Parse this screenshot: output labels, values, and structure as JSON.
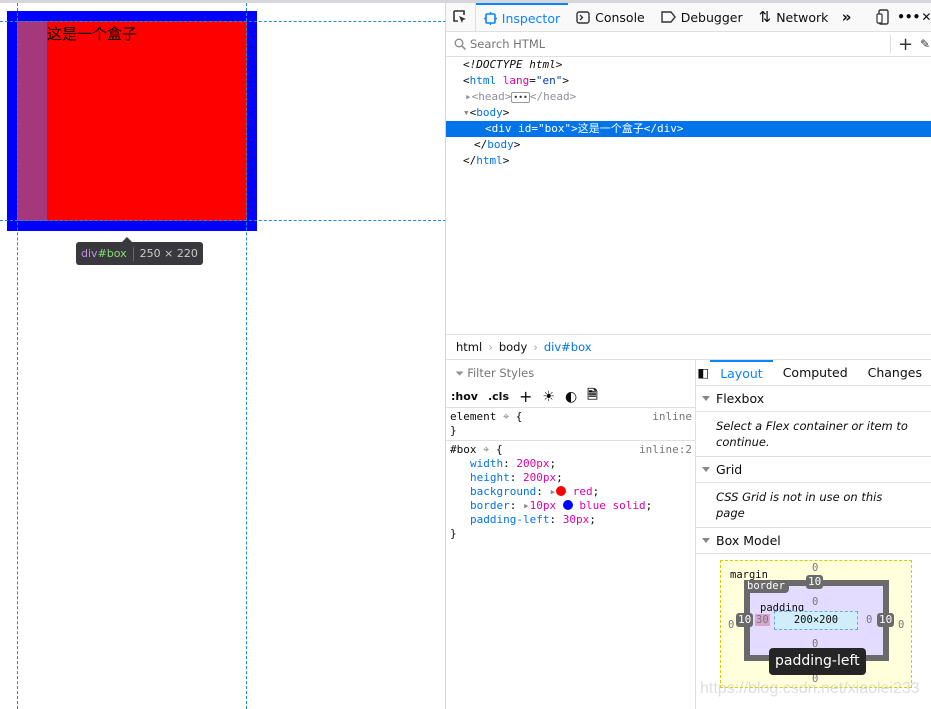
{
  "page": {
    "box_text": "这是一个盒子",
    "tooltip": {
      "tag": "div",
      "id": "#box",
      "size": "250 × 220"
    }
  },
  "colors": {
    "accent": "#0a84ff",
    "box_background": "#ff0000",
    "box_border": "#0000ff",
    "padding_highlight": "#a5387a"
  },
  "toolbar": {
    "tabs": [
      {
        "label": "Inspector",
        "icon": "inspector-icon"
      },
      {
        "label": "Console",
        "icon": "console-icon"
      },
      {
        "label": "Debugger",
        "icon": "debugger-icon"
      },
      {
        "label": "Network",
        "icon": "network-icon"
      }
    ],
    "more_icon": "chevrons-right-icon"
  },
  "search": {
    "placeholder": "Search HTML"
  },
  "tree": {
    "doctype": "<!DOCTYPE html>",
    "html_open": "html",
    "lang_attr": "lang",
    "lang_val": "\"en\"",
    "head": "head",
    "body": "body",
    "div_line": "<div id=\"box\">这是一个盒子</div>",
    "html_close": "html"
  },
  "breadcrumb": [
    "html",
    "body",
    "div#box"
  ],
  "rules": {
    "filter_placeholder": "Filter Styles",
    "hov": ":hov",
    "cls": ".cls",
    "element_selector": "element",
    "element_source": "inline",
    "box_selector": "#box",
    "box_source": "inline:2",
    "props": [
      {
        "name": "width",
        "value": "200px"
      },
      {
        "name": "height",
        "value": "200px"
      },
      {
        "name": "background",
        "value": "red"
      },
      {
        "name": "border",
        "value": "10px",
        "value2": "blue solid"
      },
      {
        "name": "padding-left",
        "value": "30px"
      }
    ]
  },
  "layout": {
    "tabs": [
      "Layout",
      "Computed",
      "Changes"
    ],
    "flexbox": {
      "title": "Flexbox",
      "note": "Select a Flex container or item to continue."
    },
    "grid": {
      "title": "Grid",
      "note": "CSS Grid is not in use on this page"
    },
    "boxmodel": {
      "title": "Box Model",
      "margin_label": "margin",
      "border_label": "border",
      "padding_label": "padding",
      "content": "200×200",
      "margin": {
        "top": "0",
        "right": "0",
        "bottom": "0",
        "left": "0"
      },
      "border": {
        "top": "10",
        "right": "10",
        "bottom": "10",
        "left": "10"
      },
      "padding": {
        "top": "0",
        "right": "0",
        "bottom": "0",
        "left": "30"
      },
      "tooltip": "padding-left"
    }
  },
  "watermark": "https://blog.csdn.net/xiaolei233"
}
